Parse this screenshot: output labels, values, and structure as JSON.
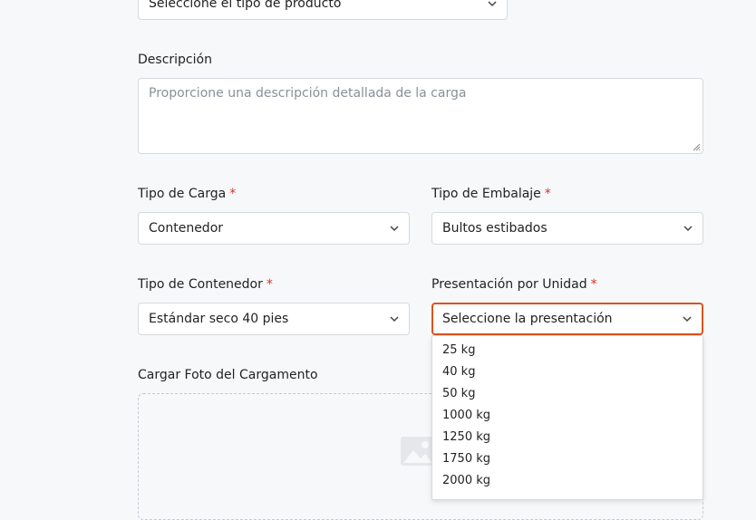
{
  "product_type": {
    "selected": "Seleccione el tipo de producto"
  },
  "description": {
    "label": "Descripción",
    "placeholder": "Proporcione una descripción detallada de la carga"
  },
  "cargo_type": {
    "label": "Tipo de Carga",
    "required_mark": "*",
    "selected": "Contenedor"
  },
  "packaging_type": {
    "label": "Tipo de Embalaje",
    "required_mark": "*",
    "selected": "Bultos estibados"
  },
  "container_type": {
    "label": "Tipo de Contenedor",
    "required_mark": "*",
    "selected": "Estándar seco 40 pies"
  },
  "unit_presentation": {
    "label": "Presentación por Unidad",
    "required_mark": "*",
    "selected": "Seleccione la presentación",
    "options": [
      "25 kg",
      "40 kg",
      "50 kg",
      "1000 kg",
      "1250 kg",
      "1750 kg",
      "2000 kg"
    ]
  },
  "upload": {
    "label": "Cargar Foto del Cargamento",
    "icon": "image-icon"
  },
  "colors": {
    "required": "#d93025",
    "focus_border": "#d9541e",
    "background": "#f7f8fa"
  }
}
